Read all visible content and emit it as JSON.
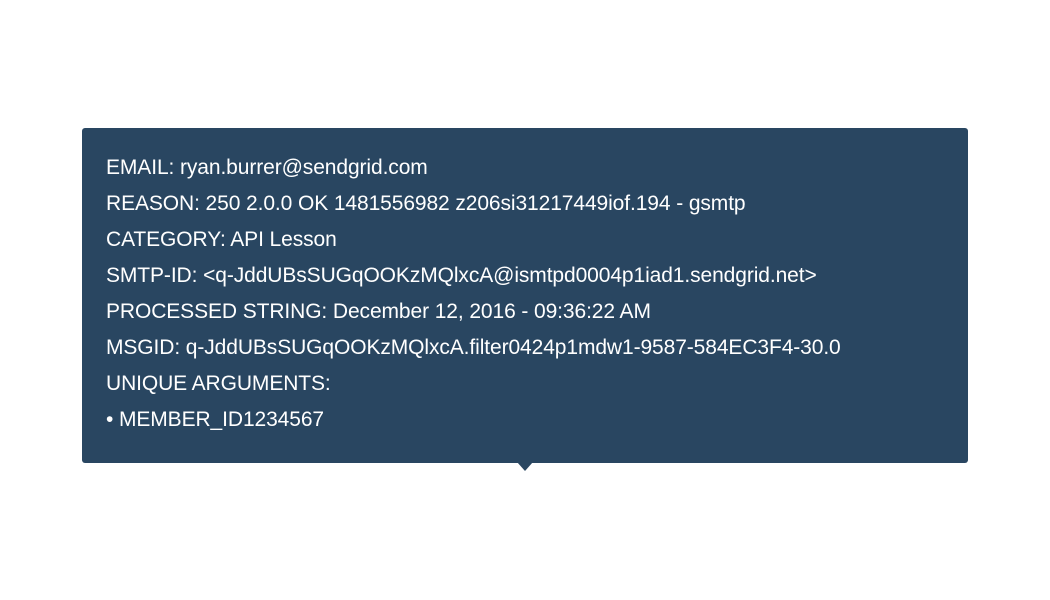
{
  "tooltip": {
    "email": "EMAIL: ryan.burrer@sendgrid.com",
    "reason": "REASON: 250 2.0.0 OK 1481556982 z206si31217449iof.194 - gsmtp",
    "category": "CATEGORY: API Lesson",
    "smtp_id": "SMTP-ID: <q-JddUBsSUGqOOKzMQlxcA@ismtpd0004p1iad1.sendgrid.net>",
    "processed_string": "PROCESSED STRING: December 12, 2016 - 09:36:22 AM",
    "msgid": "MSGID: q-JddUBsSUGqOOKzMQlxcA.filter0424p1mdw1-9587-584EC3F4-30.0",
    "unique_arguments_label": "UNIQUE ARGUMENTS:",
    "unique_arguments": [
      "• MEMBER_ID1234567"
    ]
  },
  "colors": {
    "tooltip_background": "#294661",
    "text": "#ffffff",
    "page_background": "#ffffff"
  }
}
